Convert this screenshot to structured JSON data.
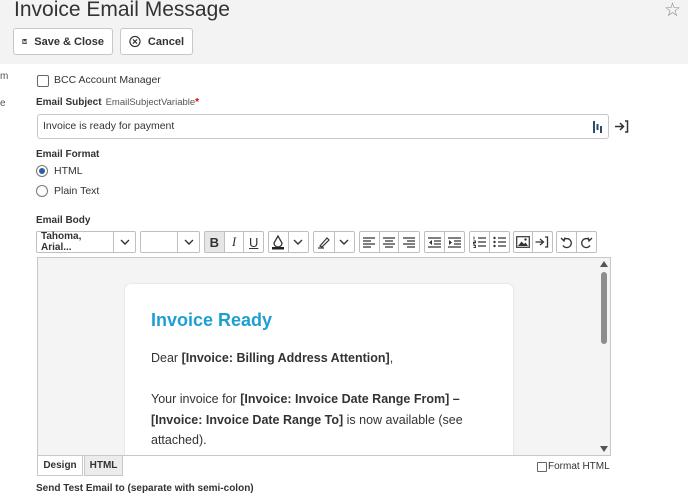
{
  "window": {
    "title": "Invoice Email Message"
  },
  "toolbar": {
    "save_close_label": "Save & Close",
    "cancel_label": "Cancel"
  },
  "sidebar_edge": {
    "fragment_1": "m",
    "fragment_2": "e"
  },
  "form": {
    "bcc_label": "BCC Account Manager",
    "subject": {
      "label": "Email Subject",
      "variable": "EmailSubjectVariable",
      "required_mark": "*",
      "value": "Invoice is ready for payment"
    },
    "format": {
      "label": "Email Format",
      "options": [
        "HTML",
        "Plain Text"
      ],
      "selected": "HTML"
    },
    "body": {
      "label": "Email Body"
    }
  },
  "editor_toolbar": {
    "font_name": "Tahoma, Arial..."
  },
  "email_preview": {
    "heading": "Invoice Ready",
    "greeting_prefix": "Dear ",
    "greeting_field": "[Invoice: Billing Address Attention]",
    "greeting_suffix": ",",
    "line1_prefix": "Your invoice for ",
    "line1_field": "[Invoice: Invoice Date Range From] –",
    "line2_field": "[Invoice: Invoice Date Range To]",
    "line2_suffix": " is now available (see",
    "line3": "attached)."
  },
  "editor_tabs": [
    "Design",
    "HTML"
  ],
  "format_html_label": "Format HTML",
  "send_test_label": "Send Test Email to (separate with semi-colon)",
  "colors": {
    "accent": "#1e9fd3",
    "radio": "#2b5fa6",
    "header_bg": "#f3f3f3"
  }
}
